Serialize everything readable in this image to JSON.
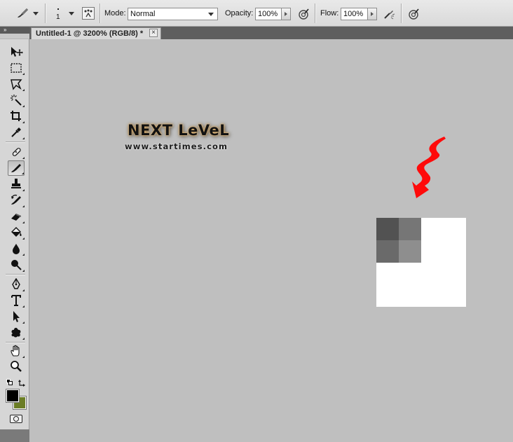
{
  "options_bar": {
    "brush_size": "1",
    "mode_label": "Mode:",
    "mode_value": "Normal",
    "opacity_label": "Opacity:",
    "opacity_value": "100%",
    "flow_label": "Flow:",
    "flow_value": "100%"
  },
  "document": {
    "tab_title": "Untitled-1 @ 3200% (RGB/8) *",
    "close_symbol": "×"
  },
  "watermark": {
    "title": "NEXT LeVeL",
    "subtitle": "www.startimes.com"
  },
  "canvas_pixels": {
    "colors": [
      "#525252",
      "#767676",
      "#6a6a6a",
      "#8e8e8e"
    ]
  },
  "colors": {
    "foreground": "#000000",
    "background": "#6b7d25",
    "annotation_arrow": "#ff0000"
  },
  "tools": [
    "move-icon",
    "marquee-icon",
    "lasso-icon",
    "magic-wand-icon",
    "crop-icon",
    "eyedropper-icon",
    "healing-brush-icon",
    "brush-icon",
    "clone-stamp-icon",
    "history-brush-icon",
    "eraser-icon",
    "paint-bucket-icon",
    "blur-icon",
    "dodge-icon",
    "pen-icon",
    "type-icon",
    "path-selection-icon",
    "custom-shape-icon",
    "hand-icon",
    "zoom-icon"
  ]
}
